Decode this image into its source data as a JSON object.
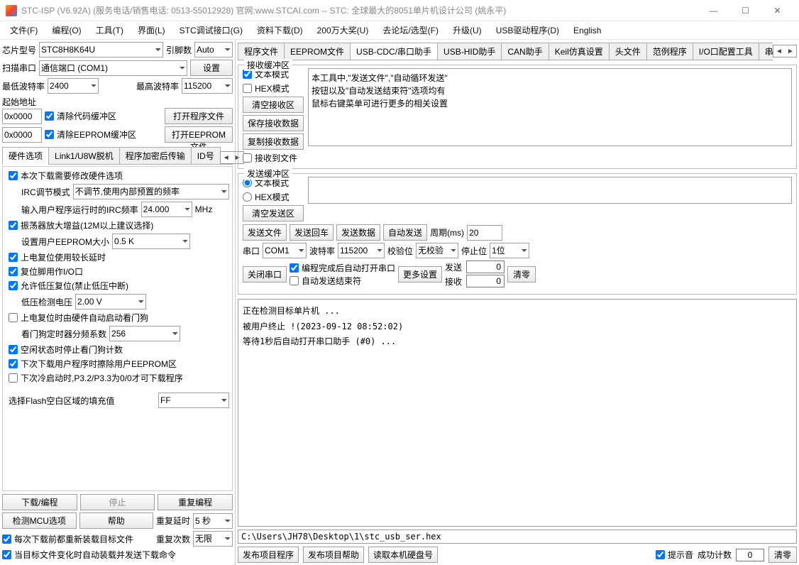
{
  "window": {
    "title": "STC-ISP (V6.92A) (服务电话/销售电话: 0513-55012928) 官网:www.STCAI.com  -- STC: 全球最大的8051单片机设计公司 (姚永平)"
  },
  "menubar": [
    "文件(F)",
    "编程(O)",
    "工具(T)",
    "界面(L)",
    "STC调试接口(G)",
    "资料下载(D)",
    "200万大奖(U)",
    "去论坛/选型(F)",
    "升级(U)",
    "USB驱动程序(D)",
    "English"
  ],
  "left": {
    "chip_label": "芯片型号",
    "chip_value": "STC8H8K64U",
    "pin_label": "引脚数",
    "pin_value": "Auto",
    "scan_label": "扫描串口",
    "scan_value": "通信端口 (COM1)",
    "settings_btn": "设置",
    "min_baud_label": "最低波特率",
    "min_baud": "2400",
    "max_baud_label": "最高波特率",
    "max_baud": "115200",
    "start_addr_label": "起始地址",
    "addr1": "0x0000",
    "clear_code": "清除代码缓冲区",
    "open_prog": "打开程序文件",
    "addr2": "0x0000",
    "clear_eeprom": "清除EEPROM缓冲区",
    "open_eeprom": "打开EEPROM文件",
    "hw_tabs": [
      "硬件选项",
      "Link1/U8W脱机",
      "程序加密后传输",
      "ID号"
    ],
    "hw": {
      "modify_opt": "本次下载需要修改硬件选项",
      "irc_mode_label": "IRC调节模式",
      "irc_mode": "不调节,使用内部预置的频率",
      "irc_freq_label": "输入用户程序运行时的IRC频率",
      "irc_freq": "24.000",
      "irc_unit": "MHz",
      "osc_gain": "振荡器放大增益(12M以上建议选择)",
      "eeprom_size_label": "设置用户EEPROM大小",
      "eeprom_size": "0.5 K",
      "long_delay": "上电复位使用较长延时",
      "reset_io": "复位脚用作I/O口",
      "low_volt": "允许低压复位(禁止低压中断)",
      "low_volt_val_label": "低压检测电压",
      "low_volt_val": "2.00 V",
      "watchdog": "上电复位时由硬件自动启动看门狗",
      "watchdog_div_label": "看门狗定时器分频系数",
      "watchdog_div": "256",
      "idle_wdt": "空闲状态时停止看门狗计数",
      "erase_eeprom": "下次下载用户程序时擦除用户EEPROM区",
      "cold_boot": "下次冷启动时,P3.2/P3.3为0/0才可下载程序",
      "flash_fill_label": "选择Flash空白区域的填充值",
      "flash_fill": "FF"
    },
    "bottom": {
      "download": "下载/编程",
      "stop": "停止",
      "reprogram": "重复编程",
      "detect": "检测MCU选项",
      "help": "帮助",
      "repeat_delay_label": "重复延时",
      "repeat_delay": "5 秒",
      "repeat_count_label": "重复次数",
      "repeat_count": "无限",
      "chk1": "每次下载前都重新装载目标文件",
      "chk2": "当目标文件变化时自动装载并发送下载命令"
    }
  },
  "right": {
    "tabs": [
      "程序文件",
      "EEPROM文件",
      "USB-CDC/串口助手",
      "USB-HID助手",
      "CAN助手",
      "Keil仿真设置",
      "头文件",
      "范例程序",
      "I/O口配置工具",
      "串口波特率计算器"
    ],
    "active_tab": 2,
    "recv": {
      "title": "接收缓冲区",
      "text_mode": "文本模式",
      "hex_mode": "HEX模式",
      "clear": "清空接收区",
      "save": "保存接收数据",
      "copy": "复制接收数据",
      "tofile": "接收到文件",
      "lines": [
        "本工具中,\"发送文件\",\"自动循环发送\"",
        "按钮以及\"自动发送结束符\"选项均有",
        "鼠标右键菜单可进行更多的相关设置"
      ]
    },
    "send": {
      "title": "发送缓冲区",
      "text_mode": "文本模式",
      "hex_mode": "HEX模式",
      "clear": "清空发送区",
      "send_file": "发送文件",
      "send_cr": "发送回车",
      "send_data": "发送数据",
      "auto_send": "自动发送",
      "period_label": "周期(ms)",
      "period": "20"
    },
    "serial": {
      "port_label": "串口",
      "port": "COM1",
      "baud_label": "波特率",
      "baud": "115200",
      "parity_label": "校验位",
      "parity": "无校验",
      "stop_label": "停止位",
      "stop": "1位",
      "close_btn": "关闭串口",
      "auto_open": "编程完成后自动打开串口",
      "auto_end": "自动发送结束符",
      "more": "更多设置",
      "tx_label": "发送",
      "tx": "0",
      "rx_label": "接收",
      "rx": "0",
      "clear": "清零"
    },
    "log": [
      "正在检测目标单片机 ...",
      "",
      "被用户终止 !(2023-09-12 08:52:02)",
      "",
      "等待1秒后自动打开串口助手 (#0) ..."
    ],
    "file_path": "C:\\Users\\JH78\\Desktop\\1\\stc_usb_ser.hex",
    "footer": {
      "pub_prog": "发布项目程序",
      "pub_help": "发布项目帮助",
      "read_hdd": "读取本机硬盘号",
      "sound": "提示音",
      "success_label": "成功计数",
      "success": "0",
      "clear": "清零"
    }
  }
}
